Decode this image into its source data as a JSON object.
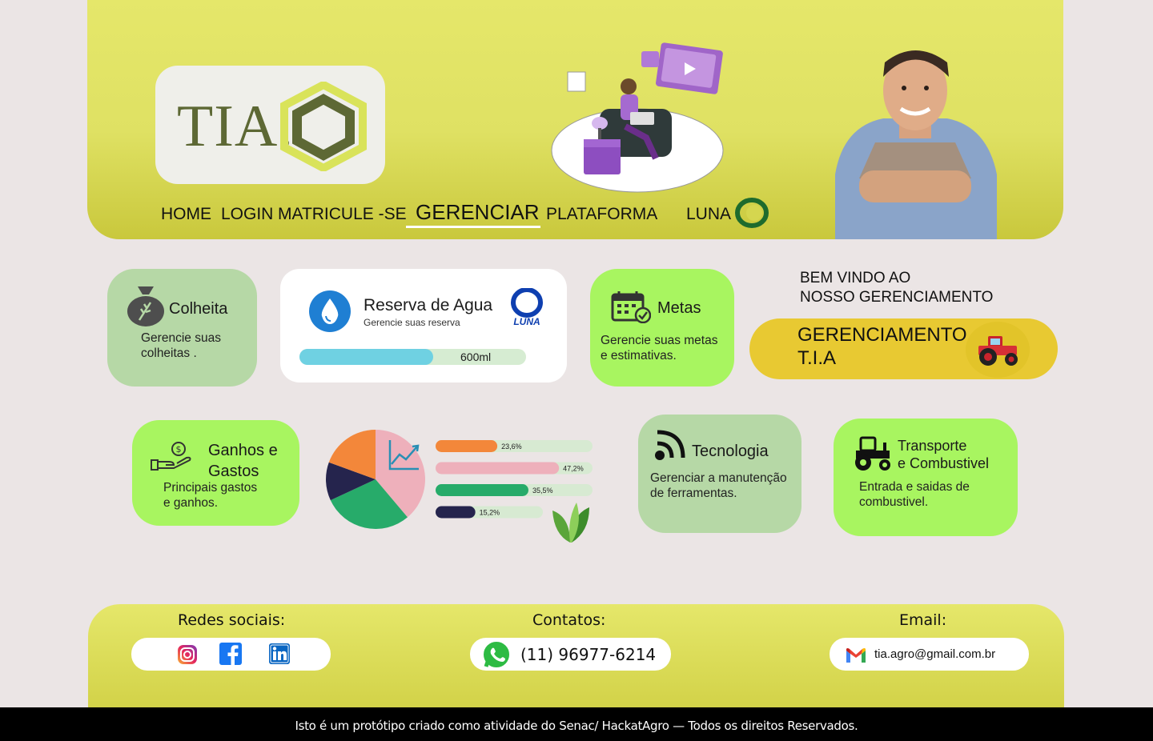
{
  "brand": {
    "logo_text": "TIA."
  },
  "nav": {
    "items": [
      "HOME",
      "LOGIN",
      "MATRICULE -SE",
      "GERENCIAR",
      "PLATAFORMA",
      "LUNA"
    ],
    "active": "GERENCIAR"
  },
  "cards": {
    "colheita": {
      "title": "Colheita",
      "desc": "Gerencie suas\ncolheitas ."
    },
    "reserva": {
      "title": "Reserva de Agua",
      "subtitle": "Gerencie suas reserva",
      "value": "600ml",
      "level": 0.59,
      "brand": "LUNA"
    },
    "metas": {
      "title": "Metas",
      "desc": "Gerencie suas metas\ne estimativas."
    },
    "ganhos": {
      "title": "Ganhos e\nGastos",
      "desc": "Principais gastos\ne ganhos."
    },
    "tecnologia": {
      "title": "Tecnologia",
      "desc": "Gerenciar a manutenção\nde ferramentas."
    },
    "transporte": {
      "title": "Transporte\ne Combustivel",
      "desc": "Entrada e saidas de\ncombustivel."
    }
  },
  "welcome": {
    "text": "BEM VINDO AO\nNOSSO GERENCIAMENTO"
  },
  "gerenciamento_button": {
    "label": "GERENCIAMENTO\nT.I.A"
  },
  "chart_data": {
    "type": "bar",
    "categories": [
      "",
      "",
      "",
      ""
    ],
    "values": [
      23.6,
      47.2,
      35.5,
      15.2
    ],
    "value_labels": [
      "23,6%",
      "47,2%",
      "35,5%",
      "15,2%"
    ],
    "colors": [
      "#f3873a",
      "#eeb0bb",
      "#27ab6a",
      "#25244d"
    ],
    "title": "",
    "xlabel": "",
    "ylabel": "",
    "xlim": [
      0,
      60
    ]
  },
  "pie_colors": [
    "#f3873a",
    "#eeb0bb",
    "#27ab6a",
    "#25244d"
  ],
  "footer": {
    "social_label": "Redes sociais:",
    "contacts_label": "Contatos:",
    "email_label": "Email:",
    "phone": "(11) 96977-6214",
    "email": "tia.agro@gmail.com.br",
    "social_icons": [
      "instagram-icon",
      "facebook-icon",
      "linkedin-icon"
    ],
    "copyright": "Isto é um protótipo criado como atividade do Senac/ HackatAgro — Todos os direitos Reservados."
  },
  "colors": {
    "header": "#e2e466",
    "lime_card": "#a8f560",
    "green_card": "#b6d8a6",
    "accent": "#e8c932"
  }
}
